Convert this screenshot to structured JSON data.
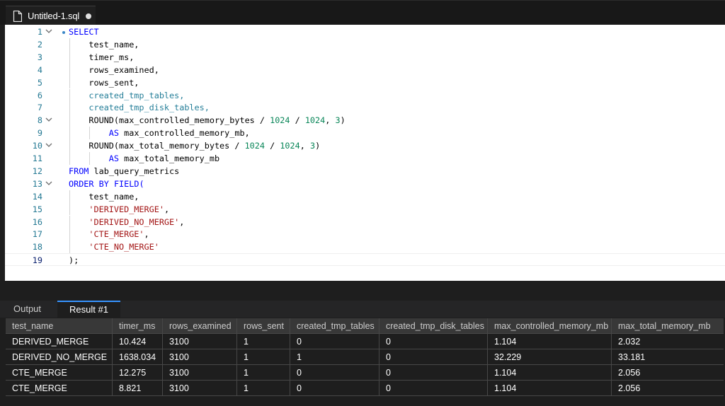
{
  "editor_tab": {
    "title": "Untitled-1.sql",
    "icon": "file-icon",
    "dirty": true
  },
  "editor": {
    "active_line": 19,
    "lines": [
      {
        "n": "1",
        "fold": true,
        "bullet": true,
        "indent": 0,
        "tokens": [
          {
            "t": "SELECT",
            "c": "kw"
          }
        ]
      },
      {
        "n": "2",
        "fold": false,
        "indent": 1,
        "tokens": [
          {
            "t": "test_name,",
            "c": ""
          }
        ]
      },
      {
        "n": "3",
        "fold": false,
        "indent": 1,
        "tokens": [
          {
            "t": "timer_ms,",
            "c": ""
          }
        ]
      },
      {
        "n": "4",
        "fold": false,
        "indent": 1,
        "tokens": [
          {
            "t": "rows_examined,",
            "c": ""
          }
        ]
      },
      {
        "n": "5",
        "fold": false,
        "indent": 1,
        "tokens": [
          {
            "t": "rows_sent,",
            "c": ""
          }
        ]
      },
      {
        "n": "6",
        "fold": false,
        "indent": 1,
        "tokens": [
          {
            "t": "created_tmp_tables,",
            "c": "col2"
          }
        ]
      },
      {
        "n": "7",
        "fold": false,
        "indent": 1,
        "tokens": [
          {
            "t": "created_tmp_disk_tables,",
            "c": "col2"
          }
        ]
      },
      {
        "n": "8",
        "fold": true,
        "indent": 1,
        "tokens": [
          {
            "t": "ROUND",
            "c": ""
          },
          {
            "t": "(max_controlled_memory_bytes / ",
            "c": ""
          },
          {
            "t": "1024",
            "c": "num"
          },
          {
            "t": " / ",
            "c": ""
          },
          {
            "t": "1024",
            "c": "num"
          },
          {
            "t": ", ",
            "c": ""
          },
          {
            "t": "3",
            "c": "num"
          },
          {
            "t": ")",
            "c": ""
          }
        ]
      },
      {
        "n": "9",
        "fold": false,
        "indent": 2,
        "tokens": [
          {
            "t": "AS",
            "c": "kw"
          },
          {
            "t": " max_controlled_memory_mb,",
            "c": ""
          }
        ]
      },
      {
        "n": "10",
        "fold": true,
        "indent": 1,
        "tokens": [
          {
            "t": "ROUND",
            "c": ""
          },
          {
            "t": "(max_total_memory_bytes / ",
            "c": ""
          },
          {
            "t": "1024",
            "c": "num"
          },
          {
            "t": " / ",
            "c": ""
          },
          {
            "t": "1024",
            "c": "num"
          },
          {
            "t": ", ",
            "c": ""
          },
          {
            "t": "3",
            "c": "num"
          },
          {
            "t": ")",
            "c": ""
          }
        ]
      },
      {
        "n": "11",
        "fold": false,
        "indent": 2,
        "tokens": [
          {
            "t": "AS",
            "c": "kw"
          },
          {
            "t": " max_total_memory_mb",
            "c": ""
          }
        ]
      },
      {
        "n": "12",
        "fold": false,
        "indent": 0,
        "tokens": [
          {
            "t": "FROM",
            "c": "kw"
          },
          {
            "t": " lab_query_metrics",
            "c": ""
          }
        ]
      },
      {
        "n": "13",
        "fold": true,
        "indent": 0,
        "tokens": [
          {
            "t": "ORDER BY",
            "c": "kw"
          },
          {
            "t": " ",
            "c": ""
          },
          {
            "t": "FIELD(",
            "c": "kw"
          }
        ]
      },
      {
        "n": "14",
        "fold": false,
        "indent": 1,
        "tokens": [
          {
            "t": "test_name,",
            "c": ""
          }
        ]
      },
      {
        "n": "15",
        "fold": false,
        "indent": 1,
        "tokens": [
          {
            "t": "'DERIVED_MERGE'",
            "c": "str"
          },
          {
            "t": ",",
            "c": ""
          }
        ]
      },
      {
        "n": "16",
        "fold": false,
        "indent": 1,
        "tokens": [
          {
            "t": "'DERIVED_NO_MERGE'",
            "c": "str"
          },
          {
            "t": ",",
            "c": ""
          }
        ]
      },
      {
        "n": "17",
        "fold": false,
        "indent": 1,
        "tokens": [
          {
            "t": "'CTE_MERGE'",
            "c": "str"
          },
          {
            "t": ",",
            "c": ""
          }
        ]
      },
      {
        "n": "18",
        "fold": false,
        "indent": 1,
        "tokens": [
          {
            "t": "'CTE_NO_MERGE'",
            "c": "str"
          }
        ]
      },
      {
        "n": "19",
        "fold": false,
        "indent": 0,
        "tokens": [
          {
            "t": ");",
            "c": ""
          }
        ]
      }
    ]
  },
  "panel": {
    "tabs": [
      {
        "label": "Output",
        "active": false
      },
      {
        "label": "Result #1",
        "active": true
      }
    ]
  },
  "results": {
    "columns": [
      "test_name",
      "timer_ms",
      "rows_examined",
      "rows_sent",
      "created_tmp_tables",
      "created_tmp_disk_tables",
      "max_controlled_memory_mb",
      "max_total_memory_mb"
    ],
    "rows": [
      [
        "DERIVED_MERGE",
        "10.424",
        "3100",
        "1",
        "0",
        "0",
        "1.104",
        "2.032"
      ],
      [
        "DERIVED_NO_MERGE",
        "1638.034",
        "3100",
        "1",
        "1",
        "0",
        "32.229",
        "33.181"
      ],
      [
        "CTE_MERGE",
        "12.275",
        "3100",
        "1",
        "0",
        "0",
        "1.104",
        "2.056"
      ],
      [
        "CTE_MERGE",
        "8.821",
        "3100",
        "1",
        "0",
        "0",
        "1.104",
        "2.056"
      ]
    ]
  }
}
